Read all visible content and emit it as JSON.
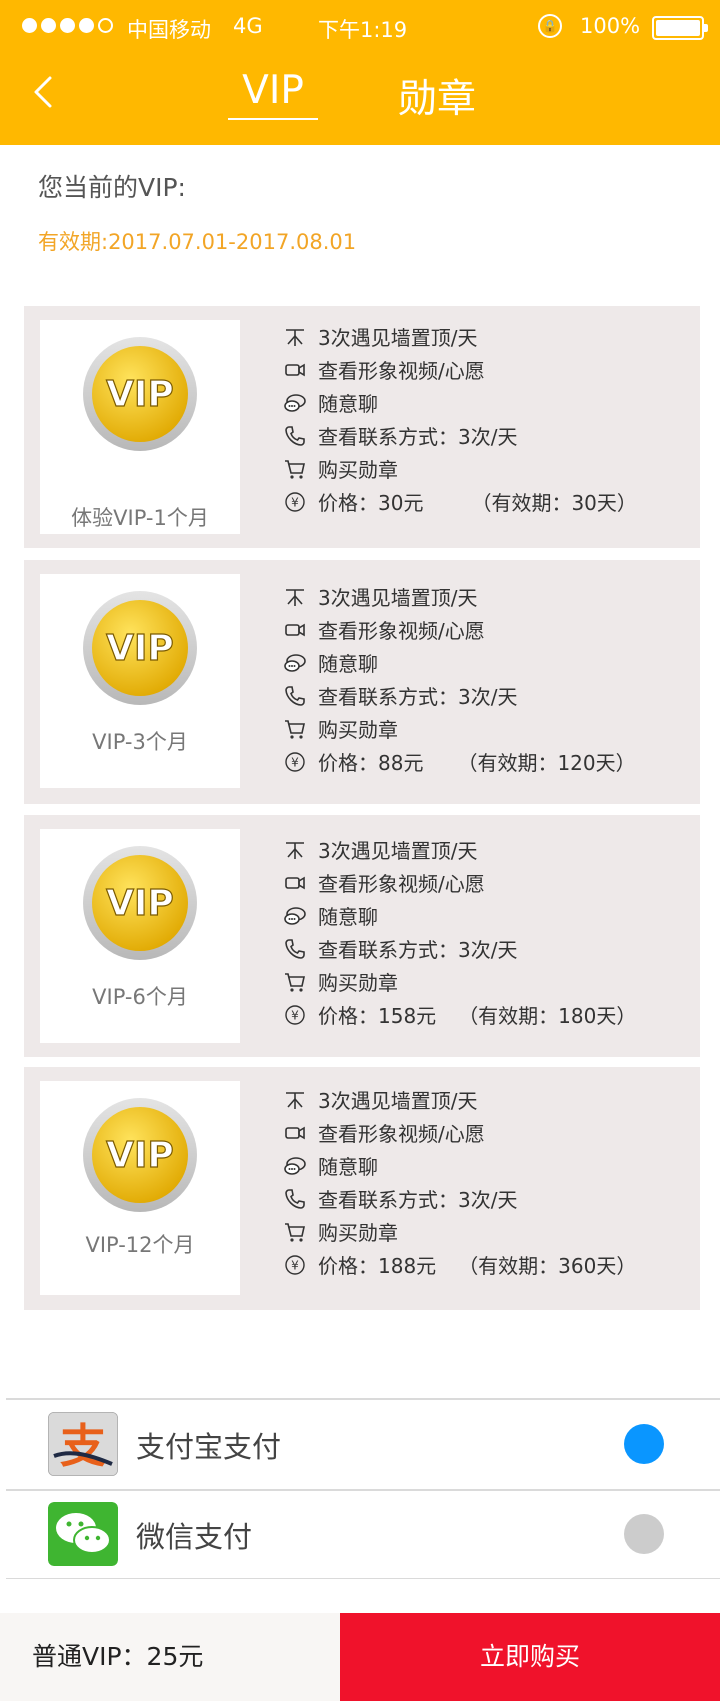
{
  "status_bar": {
    "carrier": "中国移动",
    "network": "4G",
    "time": "下午1:19",
    "battery": "100%"
  },
  "header": {
    "tabs": [
      {
        "label": "VIP",
        "active": true
      },
      {
        "label": "勋章",
        "active": false
      }
    ]
  },
  "current": {
    "label": "您当前的VIP:",
    "validity": "有效期:2017.07.01-2017.08.01"
  },
  "plans": [
    {
      "name": "体验VIP-1个月",
      "features": {
        "top": "3次遇见墙置顶/天",
        "video": "查看形象视频/心愿",
        "chat": "随意聊",
        "contact": "查看联系方式：3次/天",
        "badge": "购买勋章",
        "price": "价格：30元",
        "validity": "（有效期：30天）"
      }
    },
    {
      "name": "VIP-3个月",
      "features": {
        "top": "3次遇见墙置顶/天",
        "video": "查看形象视频/心愿",
        "chat": "随意聊",
        "contact": "查看联系方式：3次/天",
        "badge": "购买勋章",
        "price": "价格：88元",
        "validity": "（有效期：120天）"
      }
    },
    {
      "name": "VIP-6个月",
      "features": {
        "top": "3次遇见墙置顶/天",
        "video": "查看形象视频/心愿",
        "chat": "随意聊",
        "contact": "查看联系方式：3次/天",
        "badge": "购买勋章",
        "price": "价格：158元",
        "validity": "（有效期：180天）"
      }
    },
    {
      "name": "VIP-12个月",
      "features": {
        "top": "3次遇见墙置顶/天",
        "video": "查看形象视频/心愿",
        "chat": "随意聊",
        "contact": "查看联系方式：3次/天",
        "badge": "购买勋章",
        "price": "价格：188元",
        "validity": "（有效期：360天）"
      }
    }
  ],
  "medal_text": "VIP",
  "payment": [
    {
      "label": "支付宝支付",
      "selected": true,
      "icon": "alipay-icon"
    },
    {
      "label": "微信支付",
      "selected": false,
      "icon": "wechat-icon"
    }
  ],
  "footer": {
    "price_label": "普通VIP：25元",
    "buy_label": "立即购买"
  },
  "colors": {
    "header": "#FFB800",
    "validity_text": "#F2A526",
    "card_bg": "#EEE9E9",
    "radio_selected": "#0A96FF",
    "radio_unselected": "#CCCCCC",
    "buy_button": "#F0122B"
  }
}
